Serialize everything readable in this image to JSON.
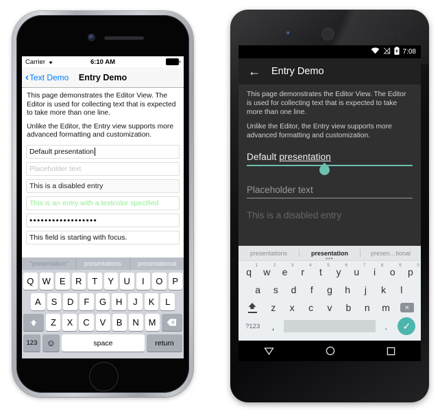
{
  "ios": {
    "status": {
      "carrier": "Carrier",
      "wifi_icon": "wifi-icon",
      "time": "6:10 AM",
      "battery_icon": "battery-icon"
    },
    "navbar": {
      "back_label": "Text Demo",
      "back_chevron": "‹",
      "title": "Entry Demo"
    },
    "paragraphs": [
      "This page demonstrates the Editor View. The Editor is used for collecting text that is expected to take more than one line.",
      "Unlike the Editor, the Entry view supports more advanced formatting and customization."
    ],
    "entries": [
      {
        "name": "default-presentation",
        "value": "Default presentation",
        "kind": "focused"
      },
      {
        "name": "placeholder-entry",
        "value": "Placeholder text",
        "kind": "placeholder"
      },
      {
        "name": "disabled-entry",
        "value": "This is a disabled entry",
        "kind": "disabled"
      },
      {
        "name": "textcolor-entry",
        "value": "This is an entry with a textcolor specified",
        "kind": "green"
      },
      {
        "name": "password-entry",
        "value": "••••••••••••••••••",
        "kind": "password"
      },
      {
        "name": "focused-entry",
        "value": "This field is starting with focus.",
        "kind": "normal"
      }
    ],
    "keyboard": {
      "suggestions": [
        "\"presentation\"",
        "presentations",
        "presentational"
      ],
      "row1": [
        "Q",
        "W",
        "E",
        "R",
        "T",
        "Y",
        "U",
        "I",
        "O",
        "P"
      ],
      "row2": [
        "A",
        "S",
        "D",
        "F",
        "G",
        "H",
        "J",
        "K",
        "L"
      ],
      "row3": [
        "Z",
        "X",
        "C",
        "V",
        "B",
        "N",
        "M"
      ],
      "shift_label": "⇧",
      "delete_label": "⌫",
      "numbers_label": "123",
      "emoji_label": "☺",
      "space_label": "space",
      "return_label": "return"
    }
  },
  "android": {
    "status": {
      "wifi_icon": "wifi-icon",
      "signal_icon": "no-signal-icon",
      "battery_icon": "battery-charging-icon",
      "time": "7:08"
    },
    "toolbar": {
      "back_icon": "back-arrow-icon",
      "title": "Entry Demo"
    },
    "paragraphs": [
      "This page demonstrates the Editor View. The Editor is used for collecting text that is expected to take more than one line.",
      "Unlike the Editor, the Entry view supports more advanced formatting and customization."
    ],
    "fields": [
      {
        "name": "default-presentation",
        "prefix": "Default ",
        "selected": "presentation",
        "kind": "focused"
      },
      {
        "name": "placeholder-entry",
        "value": "Placeholder text",
        "kind": "placeholder"
      },
      {
        "name": "disabled-entry",
        "value": "This is a disabled entry",
        "kind": "disabled"
      }
    ],
    "keyboard": {
      "suggestions": [
        "presentations",
        "presentation",
        "presen…tional"
      ],
      "more_dots": "•••",
      "row1": [
        "q",
        "w",
        "e",
        "r",
        "t",
        "y",
        "u",
        "i",
        "o",
        "p"
      ],
      "row1_hints": [
        "1",
        "2",
        "3",
        "4",
        "5",
        "6",
        "7",
        "8",
        "9",
        "0"
      ],
      "row2": [
        "a",
        "s",
        "d",
        "f",
        "g",
        "h",
        "j",
        "k",
        "l"
      ],
      "row3": [
        "z",
        "x",
        "c",
        "v",
        "b",
        "n",
        "m"
      ],
      "shift_label": "shift-icon",
      "delete_label": "⌫",
      "symbols_label": "?123",
      "comma_label": ",",
      "period_label": ".",
      "enter_label": "✓"
    },
    "navbar": {
      "back": "back-triangle-icon",
      "home": "home-circle-icon",
      "recents": "recents-square-icon"
    }
  },
  "colors": {
    "ios_accent": "#007aff",
    "ios_green_text": "#90ee90",
    "android_teal": "#6dbfb0",
    "android_enter": "#4db6ac",
    "android_bg": "#303030",
    "android_toolbar": "#212121"
  }
}
